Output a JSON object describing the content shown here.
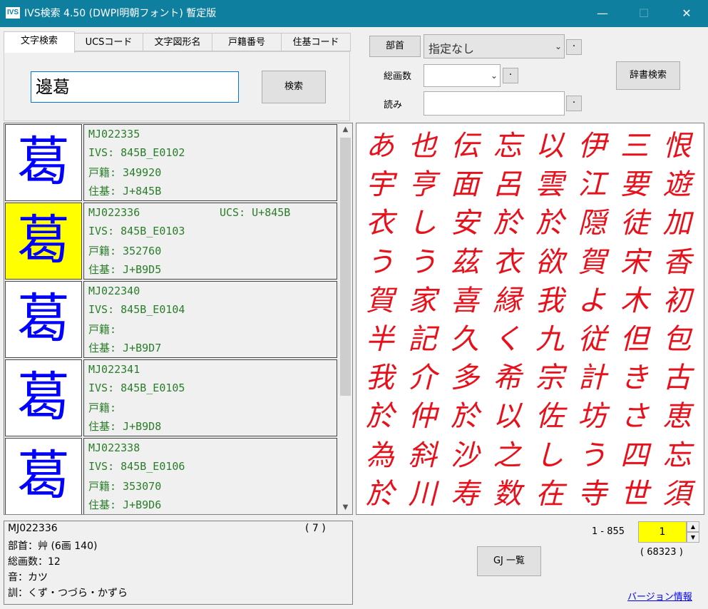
{
  "window": {
    "icon": "IVS",
    "title": "IVS検索 4.50 (DWPI明朝フォント) 暫定版",
    "minimize": "—",
    "maximize": "☐",
    "close": "✕"
  },
  "tabs": [
    "文字検索",
    "UCSコード",
    "文字図形名",
    "戸籍番号",
    "住基コード"
  ],
  "search": {
    "value": "邊葛",
    "button": "検索"
  },
  "results": [
    {
      "glyph": "葛",
      "selected": false,
      "mj": "MJ022335",
      "ucs": "",
      "ivs": "IVS: 845B_E0102",
      "koseki": "戸籍: 349920",
      "juki": "住基: J+845B"
    },
    {
      "glyph": "葛",
      "selected": true,
      "mj": "MJ022336",
      "ucs": "UCS: U+845B",
      "ivs": "IVS: 845B_E0103",
      "koseki": "戸籍: 352760",
      "juki": "住基: J+B9D5"
    },
    {
      "glyph": "葛",
      "selected": false,
      "mj": "MJ022340",
      "ucs": "",
      "ivs": "IVS: 845B_E0104",
      "koseki": "戸籍:",
      "juki": "住基: J+B9D7"
    },
    {
      "glyph": "葛",
      "selected": false,
      "mj": "MJ022341",
      "ucs": "",
      "ivs": "IVS: 845B_E0105",
      "koseki": "戸籍:",
      "juki": "住基: J+B9D8"
    },
    {
      "glyph": "葛",
      "selected": false,
      "mj": "MJ022338",
      "ucs": "",
      "ivs": "IVS: 845B_E0106",
      "koseki": "戸籍: 353070",
      "juki": "住基: J+B9D6"
    }
  ],
  "details": {
    "mj": "MJ022336",
    "count": "( 7 )",
    "bushu": "部首：艸 (6画 140)",
    "strokes": "総画数：12",
    "on": "音：カツ",
    "kun": "訓：くず・つづら・かずら"
  },
  "filters": {
    "bushu_button": "部首",
    "bushu_value": "指定なし",
    "strokes_label": "総画数",
    "strokes_value": "",
    "reading_label": "読み",
    "reading_value": "",
    "dot": "·",
    "dict_button": "辞書検索"
  },
  "grid": [
    "あ",
    "也",
    "伝",
    "忘",
    "以",
    "伊",
    "三",
    "恨",
    "宇",
    "亨",
    "面",
    "呂",
    "雲",
    "江",
    "要",
    "遊",
    "衣",
    "し",
    "安",
    "於",
    "於",
    "隠",
    "徒",
    "加",
    "う",
    "う",
    "茲",
    "衣",
    "欲",
    "賀",
    "宋",
    "香",
    "賀",
    "家",
    "喜",
    "縁",
    "我",
    "よ",
    "木",
    "初",
    "半",
    "記",
    "久",
    "く",
    "九",
    "従",
    "但",
    "包",
    "我",
    "介",
    "多",
    "希",
    "宗",
    "計",
    "き",
    "古",
    "於",
    "仲",
    "於",
    "以",
    "佐",
    "坊",
    "さ",
    "恵",
    "為",
    "斜",
    "沙",
    "之",
    "し",
    "う",
    "四",
    "忘",
    "於",
    "川",
    "寿",
    "数",
    "在",
    "寺",
    "世",
    "須"
  ],
  "paging": {
    "range": "1 - 855",
    "page": "1",
    "total": "( 68323 )",
    "up": "▲",
    "down": "▼"
  },
  "gj_button": "GJ 一覧",
  "version_link": "バージョン情報",
  "scroll": {
    "up": "▲",
    "down": "▼"
  }
}
